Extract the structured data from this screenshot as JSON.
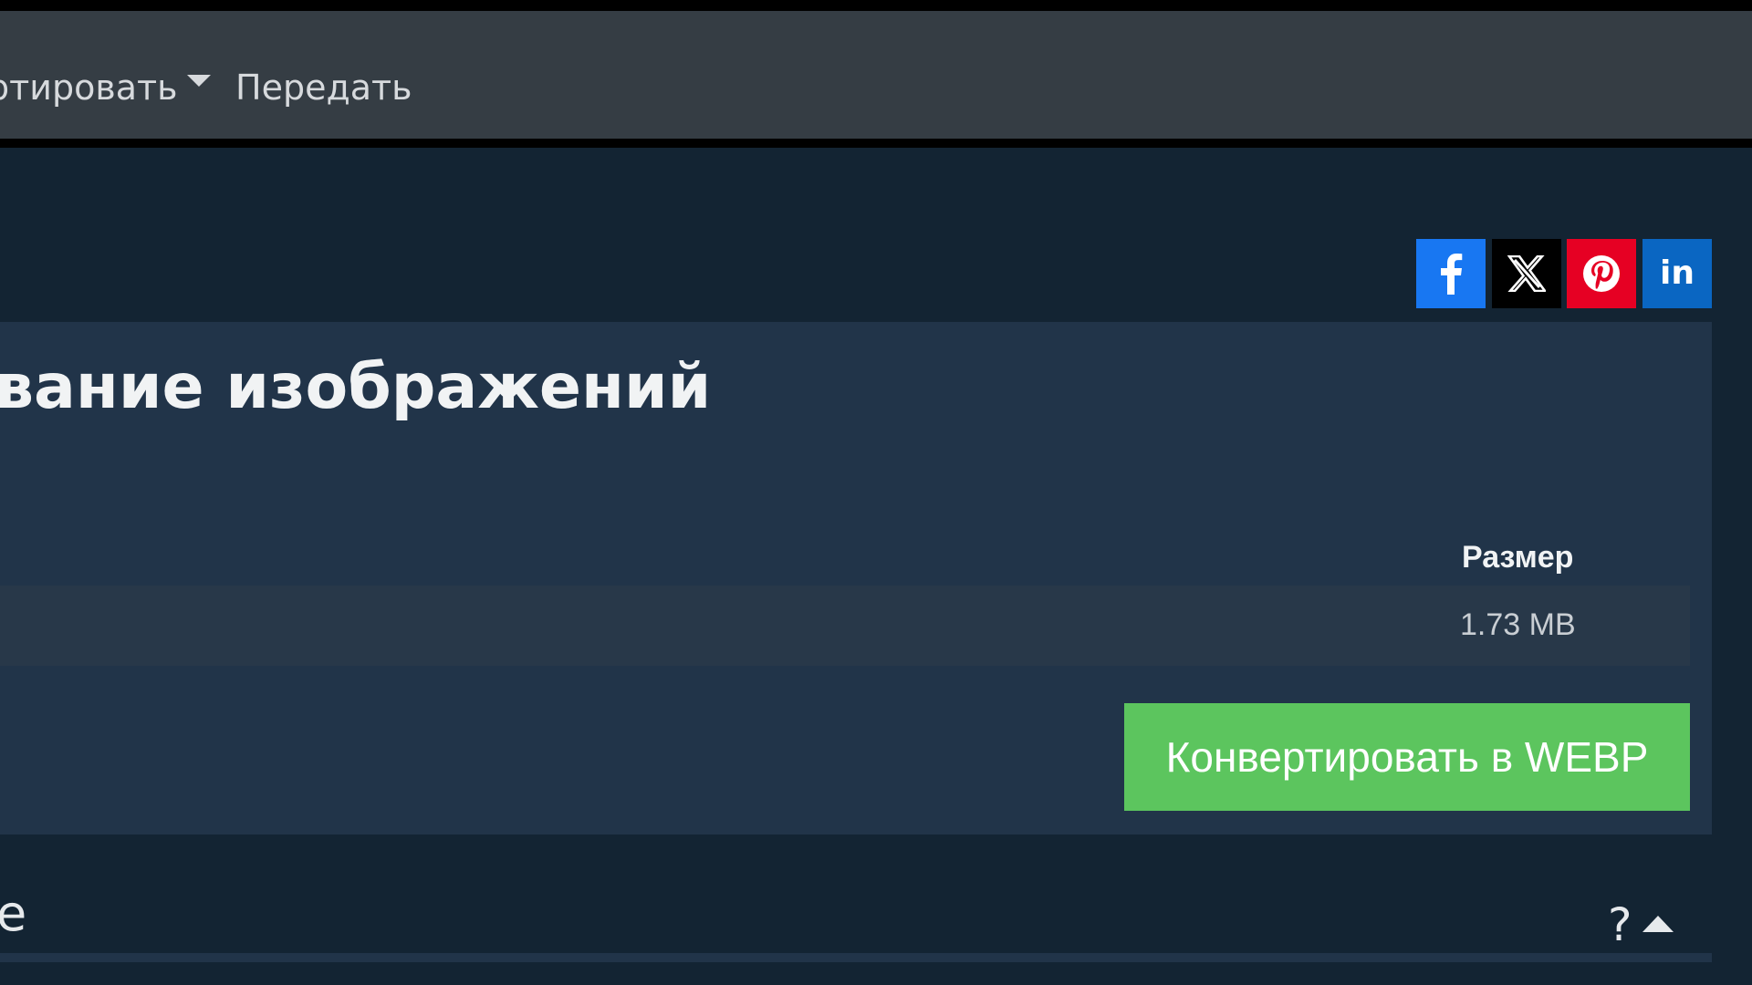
{
  "navbar": {
    "convert_label": "ртировать",
    "transfer_label": "Передать"
  },
  "social": {
    "facebook_letter": "f",
    "linkedin_label": "in"
  },
  "main": {
    "heading": "вание изображений",
    "table": {
      "columns": [
        "Размер"
      ],
      "rows": [
        {
          "size": "1.73 MB"
        }
      ]
    },
    "convert_button_label": "Конвертировать в WEBP"
  },
  "section": {
    "title_fragment": "е",
    "help_symbol": "?"
  },
  "colors": {
    "background": "#132433",
    "navbar": "#353d44",
    "panel": "#213449",
    "accent_green": "#5cc55e",
    "facebook": "#1877f2",
    "x": "#000000",
    "pinterest": "#e60023",
    "linkedin": "#0a66c2"
  },
  "icons": [
    "caret-down-icon",
    "facebook-icon",
    "x-icon",
    "pinterest-icon",
    "linkedin-icon",
    "collapse-arrow-icon"
  ]
}
